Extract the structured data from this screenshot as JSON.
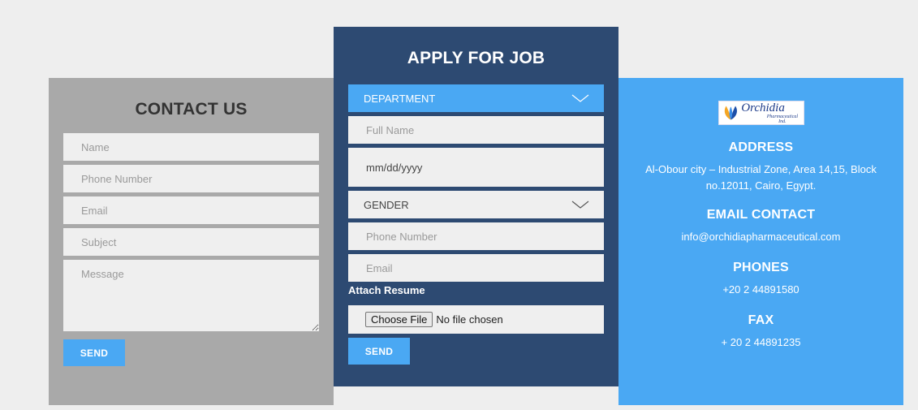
{
  "contact": {
    "title": "CONTACT US",
    "name_placeholder": "Name",
    "phone_placeholder": "Phone Number",
    "email_placeholder": "Email",
    "subject_placeholder": "Subject",
    "message_placeholder": "Message",
    "send_label": "SEND"
  },
  "apply": {
    "title": "APPLY FOR JOB",
    "department_label": "DEPARTMENT",
    "fullname_placeholder": "Full Name",
    "date_value": "mm/dd/yyyy",
    "gender_label": "GENDER",
    "phone_placeholder": "Phone Number",
    "email_placeholder": "Email",
    "attach_label": "Attach Resume",
    "choose_file_label": "Choose File",
    "no_file_text": "No file chosen",
    "send_label": "SEND"
  },
  "info": {
    "logo_name": "Orchidia",
    "logo_sub": "Pharmaceutical Ind.",
    "address_heading": "ADDRESS",
    "address_text": "Al-Obour city – Industrial Zone, Area 14,15, Block no.12011, Cairo, Egypt.",
    "email_heading": "EMAIL CONTACT",
    "email_text": "info@orchidiapharmaceutical.com",
    "phones_heading": "PHONES",
    "phones_text": "+20 2 44891580",
    "fax_heading": "FAX",
    "fax_text": "+ 20 2 44891235"
  },
  "colors": {
    "page_bg": "#eeeeee",
    "contact_bg": "#a9a9a9",
    "apply_bg": "#2d4a72",
    "info_bg": "#4aa8f3",
    "accent": "#4aa8f3",
    "field_bg": "#efefef"
  }
}
